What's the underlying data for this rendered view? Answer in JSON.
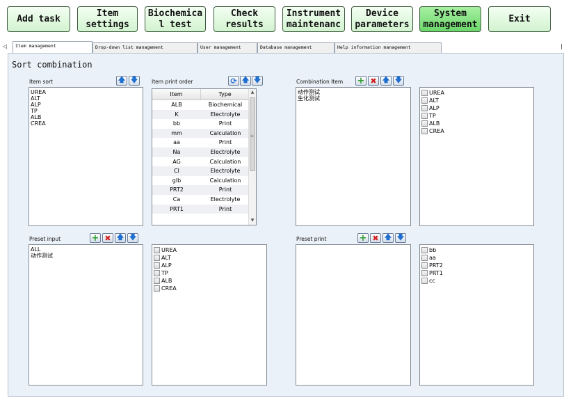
{
  "toolbar": {
    "buttons": [
      {
        "label": "Add task"
      },
      {
        "label": "Item\nsettings"
      },
      {
        "label": "Biochemica\nl test"
      },
      {
        "label": "Check\nresults"
      },
      {
        "label": "Instrument\nmaintenanc"
      },
      {
        "label": "Device\nparameters"
      },
      {
        "label": "System\nmanagement",
        "active": true
      },
      {
        "label": "Exit"
      }
    ]
  },
  "tabs": [
    {
      "label": "Item management",
      "active": true
    },
    {
      "label": "Drop-down list management"
    },
    {
      "label": "User management"
    },
    {
      "label": "Database management"
    },
    {
      "label": "Help information management"
    }
  ],
  "tab_scroll_glyph": "◁",
  "tab_right_glyph": "|",
  "section_title": "Sort combination",
  "item_sort": {
    "label": "Item sort",
    "items": [
      "UREA",
      "ALT",
      "ALP",
      "TP",
      "ALB",
      "CREA"
    ]
  },
  "item_print_order": {
    "label": "Item print order",
    "columns": [
      "Item",
      "Type"
    ],
    "rows": [
      [
        "ALB",
        "Biochemical"
      ],
      [
        "K",
        "Electrolyte"
      ],
      [
        "bb",
        "Print"
      ],
      [
        "mm",
        "Calculation"
      ],
      [
        "aa",
        "Print"
      ],
      [
        "Na",
        "Electrolyte"
      ],
      [
        "AG",
        "Calculation"
      ],
      [
        "Cl",
        "Electrolyte"
      ],
      [
        "glb",
        "Calculation"
      ],
      [
        "PRT2",
        "Print"
      ],
      [
        "Ca",
        "Electrolyte"
      ],
      [
        "PRT1",
        "Print"
      ]
    ],
    "scroll_up": "▲",
    "scroll_down": "▼",
    "scroll_grip": "≡"
  },
  "combination_item": {
    "label": "Combination Item",
    "items": [
      "动作测试",
      "生化测试"
    ]
  },
  "combination_checks": {
    "items": [
      "UREA",
      "ALT",
      "ALP",
      "TP",
      "ALB",
      "CREA"
    ]
  },
  "preset_input": {
    "label": "Preset input",
    "items": [
      "ALL",
      "动作测试"
    ]
  },
  "preset_input_checks": {
    "items": [
      "UREA",
      "ALT",
      "ALP",
      "TP",
      "ALB",
      "CREA"
    ]
  },
  "preset_print": {
    "label": "Preset print",
    "items": []
  },
  "preset_print_checks": {
    "items": [
      "bb",
      "aa",
      "PRT2",
      "PRT1",
      "cc"
    ]
  },
  "icons": {
    "up": "🡅",
    "down": "🡇",
    "add": "+",
    "delete": "✖",
    "refresh": "⟳"
  }
}
